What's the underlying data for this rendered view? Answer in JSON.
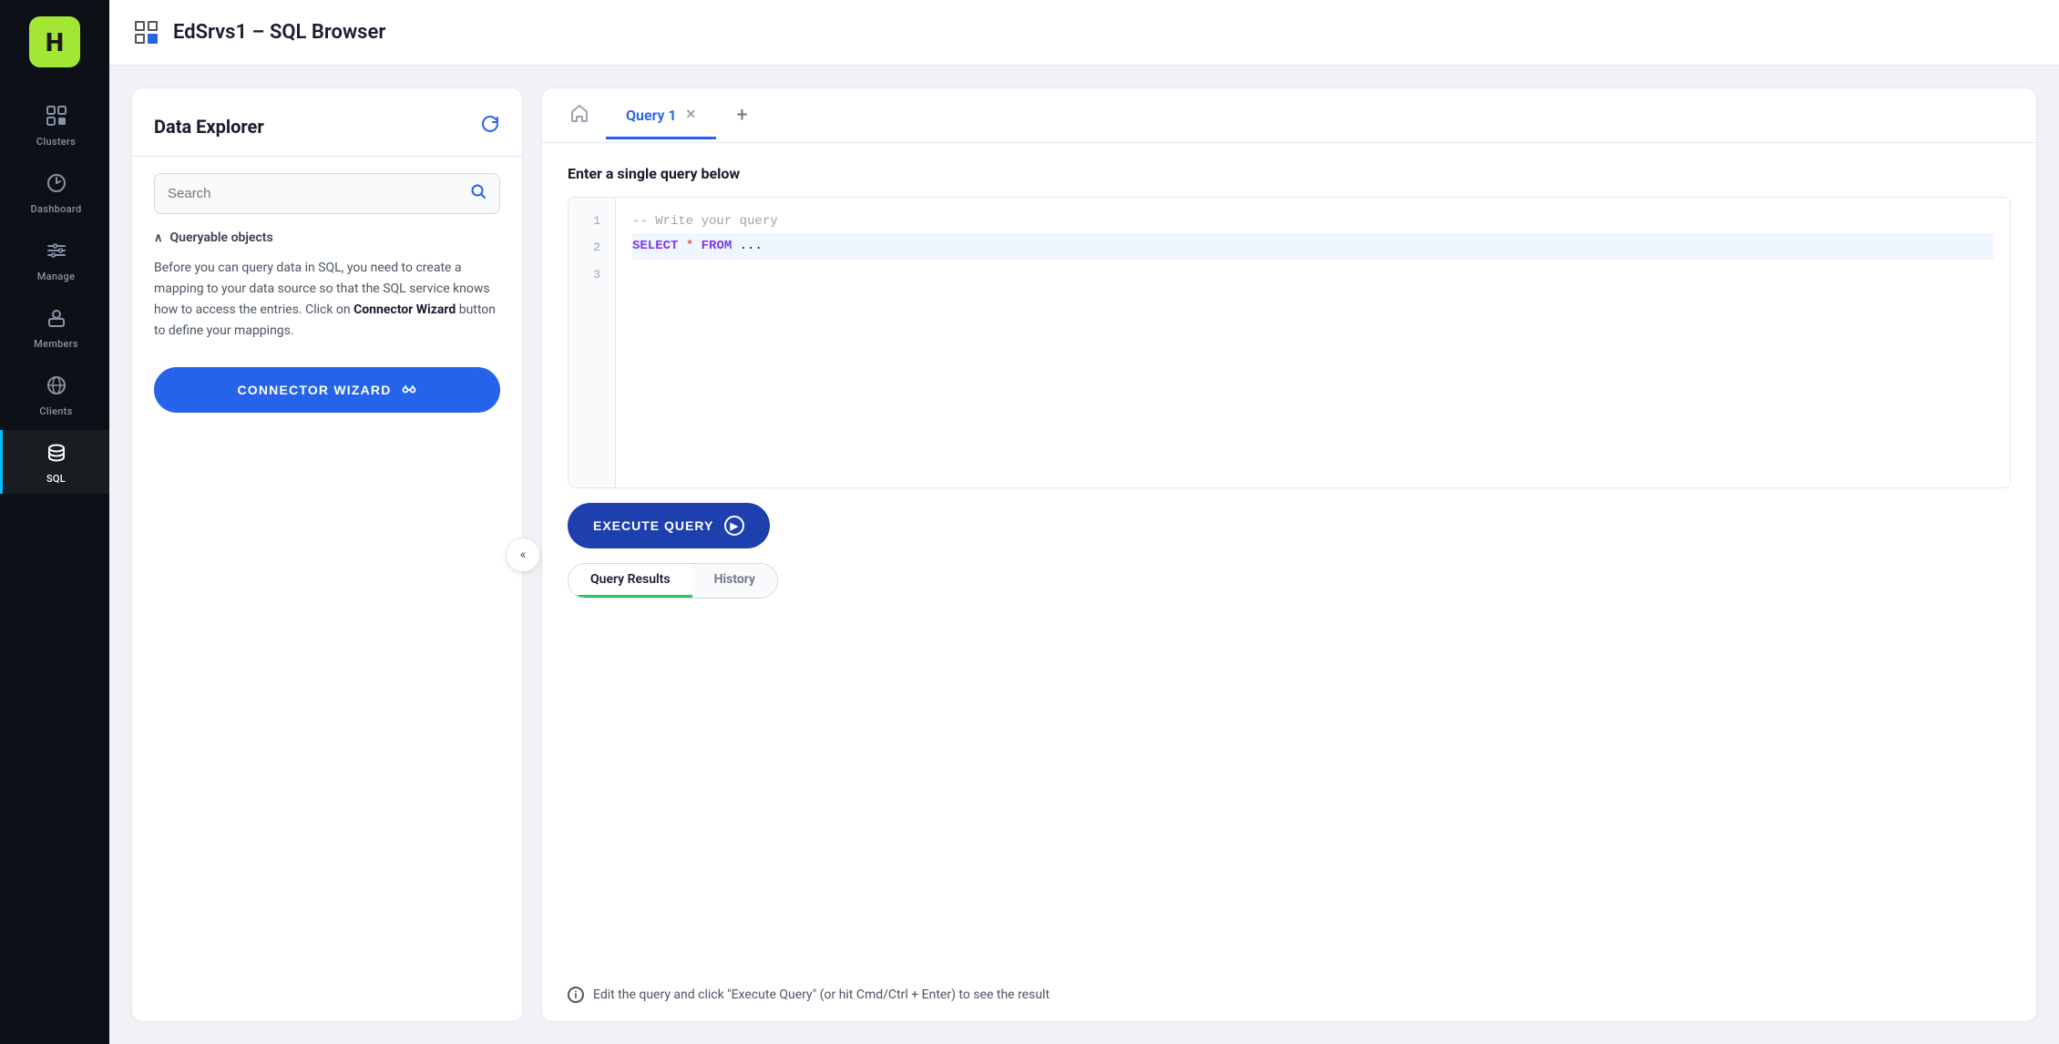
{
  "app": {
    "logo": "H",
    "title": "EdSrvs1 – SQL Browser"
  },
  "sidebar": {
    "items": [
      {
        "id": "clusters",
        "label": "Clusters",
        "icon": "clusters"
      },
      {
        "id": "dashboard",
        "label": "Dashboard",
        "icon": "dashboard"
      },
      {
        "id": "manage",
        "label": "Manage",
        "icon": "manage"
      },
      {
        "id": "members",
        "label": "Members",
        "icon": "members"
      },
      {
        "id": "clients",
        "label": "Clients",
        "icon": "clients"
      },
      {
        "id": "sql",
        "label": "SQL",
        "icon": "sql",
        "active": true
      }
    ]
  },
  "data_explorer": {
    "title": "Data Explorer",
    "search_placeholder": "Search",
    "queryable_objects_label": "Queryable objects",
    "description_part1": "Before you can query data in SQL, you need to create a mapping to your data source so that the SQL service knows how to access the entries. Click on ",
    "description_bold": "Connector Wizard",
    "description_part2": " button to define your mappings.",
    "connector_btn_label": "CONNECTOR WIZARD"
  },
  "tabs": {
    "home_icon": "⌂",
    "active_tab": "Query 1",
    "add_icon": "+"
  },
  "query_editor": {
    "section_label": "Enter a single query below",
    "lines": [
      {
        "num": "1",
        "content": "comment",
        "text": "-- Write your query"
      },
      {
        "num": "2",
        "content": "code",
        "keyword1": "SELECT",
        "op": "*",
        "keyword2": "FROM",
        "rest": "..."
      },
      {
        "num": "3",
        "content": "empty",
        "text": ""
      }
    ]
  },
  "execute_btn": {
    "label": "EXECUTE QUERY"
  },
  "results": {
    "tabs": [
      {
        "id": "results",
        "label": "Query Results",
        "active": true
      },
      {
        "id": "history",
        "label": "History",
        "active": false
      }
    ],
    "info_text": "Edit the query and click \"Execute Query\" (or hit Cmd/Ctrl + Enter) to see the result"
  },
  "colors": {
    "primary": "#2563eb",
    "active_sidebar": "#00bfff",
    "logo_bg": "#a3e635",
    "keyword_color": "#7c3aed",
    "operator_color": "#dc2626",
    "active_tab_line": "#22c55e",
    "execute_btn": "#1e40af"
  }
}
